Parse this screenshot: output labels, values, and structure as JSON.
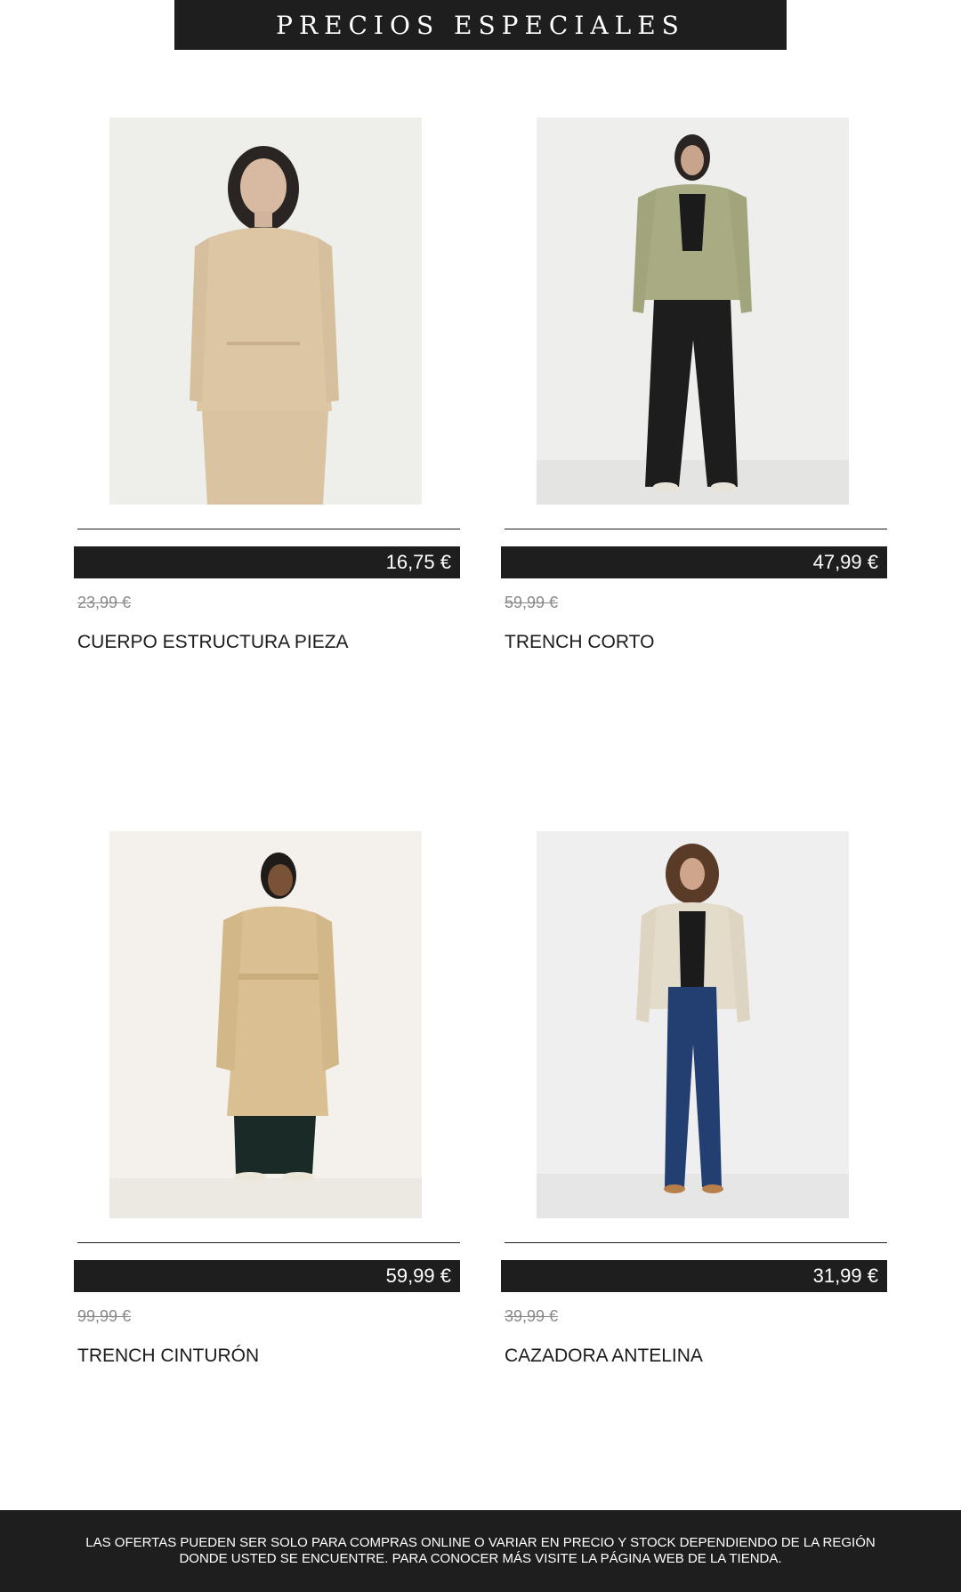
{
  "banner": {
    "title": "PRECIOS ESPECIALES"
  },
  "products": [
    {
      "name": "CUERPO ESTRUCTURA PIEZA",
      "price": "16,75 €",
      "old_price": "23,99 €",
      "image": "model-beige-textured-top"
    },
    {
      "name": "TRENCH CORTO",
      "price": "47,99 €",
      "old_price": "59,99 €",
      "image": "model-green-cropped-trench"
    },
    {
      "name": "TRENCH CINTURÓN",
      "price": "59,99 €",
      "old_price": "99,99 €",
      "image": "model-camel-belted-trench"
    },
    {
      "name": "CAZADORA ANTELINA",
      "price": "31,99 €",
      "old_price": "39,99 €",
      "image": "model-cream-suede-jacket"
    }
  ],
  "footer": {
    "disclaimer": "LAS OFERTAS PUEDEN SER SOLO PARA COMPRAS ONLINE O VARIAR EN PRECIO Y STOCK DEPENDIENDO DE LA REGIÓN DONDE USTED SE ENCUENTRE. PARA CONOCER MÁS VISITE LA PÁGINA WEB DE LA TIENDA."
  },
  "colors": {
    "dark": "#1e1e1e",
    "muted": "#888888",
    "background": "#ffffff"
  }
}
